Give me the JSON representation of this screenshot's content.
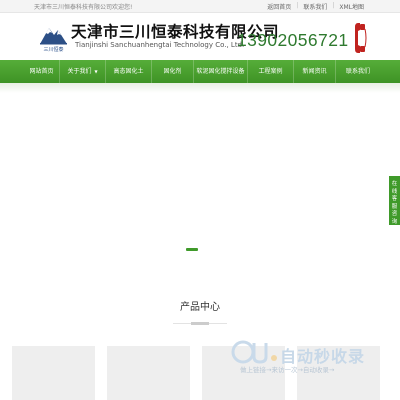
{
  "topbar": {
    "welcome": "天津市三川恒泰科技有限公司欢迎您!",
    "links": [
      "返回首页",
      "联系我们",
      "XML地图"
    ]
  },
  "header": {
    "company_cn": "天津市三川恒泰科技有限公司",
    "company_en": "Tianjinshi Sanchuanhengtai Technology Co., Ltd.",
    "logo_text": "三川恒泰",
    "phone": "13902056721"
  },
  "nav": {
    "items": [
      {
        "label": "网站首页"
      },
      {
        "label": "关于我们",
        "has_dropdown": true
      },
      {
        "label": "高态固化土"
      },
      {
        "label": "固化剂"
      },
      {
        "label": "软泥固化搅拌设备"
      },
      {
        "label": "工程案例"
      },
      {
        "label": "新闻资讯"
      },
      {
        "label": "联系我们"
      }
    ]
  },
  "side_tab": {
    "chars": [
      "在",
      "线",
      "客",
      "服",
      "咨",
      "询"
    ]
  },
  "products": {
    "title": "产品中心"
  },
  "watermark": {
    "brand": "自动秒收录",
    "tagline": "做上链接→来访一次→自动收录→"
  },
  "colors": {
    "brand_green": "#3f9a2a",
    "phone_green": "#2f7a2f",
    "phone_icon": "#c0231f"
  }
}
